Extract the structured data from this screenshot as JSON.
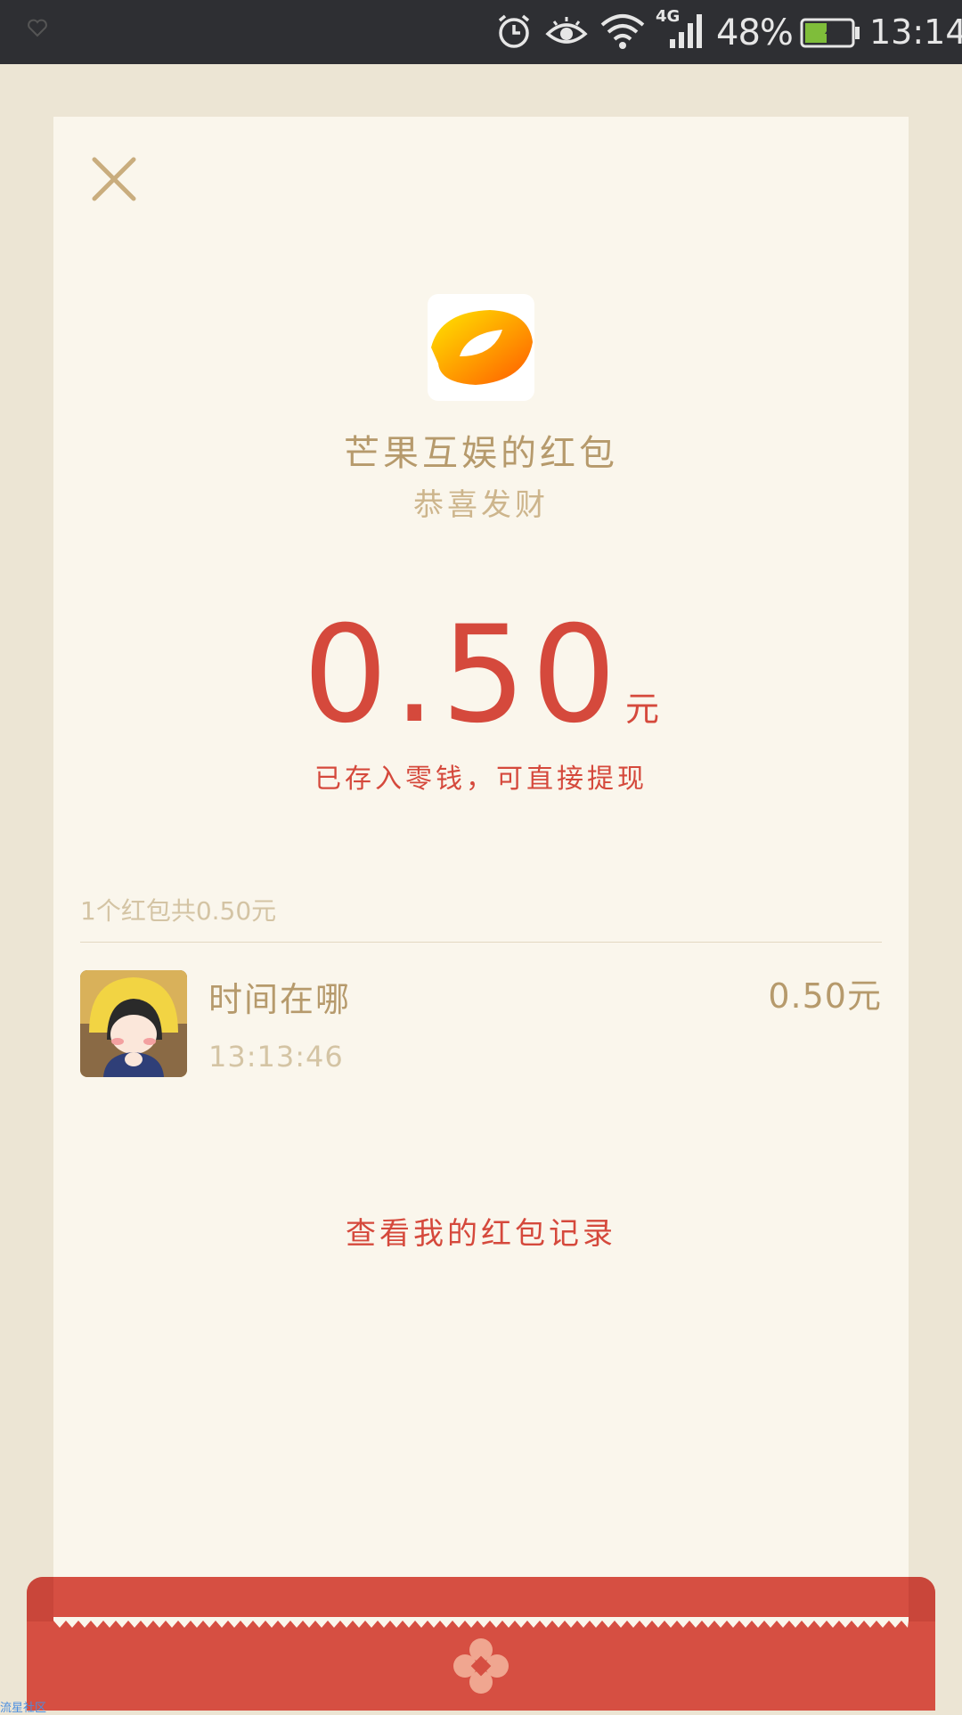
{
  "status_bar": {
    "network_type": "4G",
    "battery_percent": "48%",
    "battery_level": 0.48,
    "time": "13:14",
    "icons": [
      "heart-icon",
      "alarm-icon",
      "eye-icon",
      "wifi-icon",
      "signal-icon",
      "battery-icon"
    ]
  },
  "packet": {
    "sender_name": "芒果互娱的红包",
    "greeting": "恭喜发财",
    "amount": "0.50",
    "unit": "元",
    "deposit_note": "已存入零钱，可直接提现"
  },
  "records": {
    "summary": "1个红包共0.50元",
    "items": [
      {
        "name": "时间在哪",
        "time": "13:13:46",
        "amount": "0.50元"
      }
    ]
  },
  "history_link": "查看我的红包记录",
  "watermark": "流星社区",
  "colors": {
    "accent_red": "#d5493c",
    "text_gold": "#b69a6c",
    "card_bg": "#faf6ec",
    "page_bg": "#ece5d4"
  }
}
